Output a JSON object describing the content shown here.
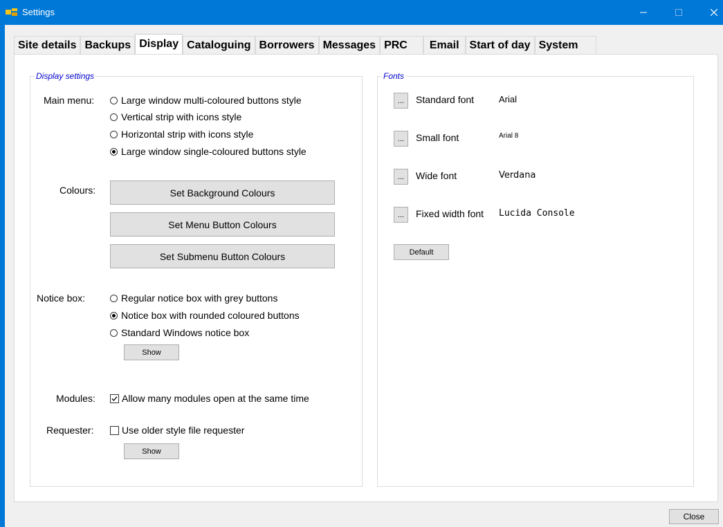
{
  "window": {
    "title": "Settings"
  },
  "tabs": [
    {
      "label": "Site details"
    },
    {
      "label": "Backups"
    },
    {
      "label": "Display"
    },
    {
      "label": "Cataloguing"
    },
    {
      "label": "Borrowers"
    },
    {
      "label": "Messages"
    },
    {
      "label": "PRC"
    },
    {
      "label": "Email"
    },
    {
      "label": "Start of day"
    },
    {
      "label": "System"
    }
  ],
  "display": {
    "group_title": "Display settings",
    "main_menu": {
      "label": "Main menu:",
      "options": [
        {
          "label": "Large window multi-coloured buttons style",
          "selected": false
        },
        {
          "label": "Vertical strip with icons style",
          "selected": false
        },
        {
          "label": "Horizontal strip with icons style",
          "selected": false
        },
        {
          "label": "Large window single-coloured buttons style",
          "selected": true
        }
      ]
    },
    "colours": {
      "label": "Colours:",
      "background_button": "Set Background Colours",
      "menu_button": "Set Menu Button Colours",
      "submenu_button": "Set Submenu Button Colours"
    },
    "notice_box": {
      "label": "Notice box:",
      "options": [
        {
          "label": "Regular notice box with grey buttons",
          "selected": false
        },
        {
          "label": "Notice box with rounded coloured buttons",
          "selected": true
        },
        {
          "label": "Standard Windows notice box",
          "selected": false
        }
      ],
      "show_button": "Show"
    },
    "modules": {
      "label": "Modules:",
      "checkbox_label": "Allow many modules open at the same time",
      "checked": true
    },
    "requester": {
      "label": "Requester:",
      "checkbox_label": "Use older style file requester",
      "checked": false,
      "show_button": "Show"
    }
  },
  "fonts": {
    "group_title": "Fonts",
    "browse_label": "...",
    "items": [
      {
        "label": "Standard font",
        "value": "Arial"
      },
      {
        "label": "Small font",
        "value": "Arial 8"
      },
      {
        "label": "Wide font",
        "value": "Verdana"
      },
      {
        "label": "Fixed width font",
        "value": "Lucida Console"
      }
    ],
    "default_button": "Default"
  },
  "footer": {
    "close_button": "Close"
  },
  "colors": {
    "accent": "#0078d7",
    "group_title": "#0000cc"
  }
}
